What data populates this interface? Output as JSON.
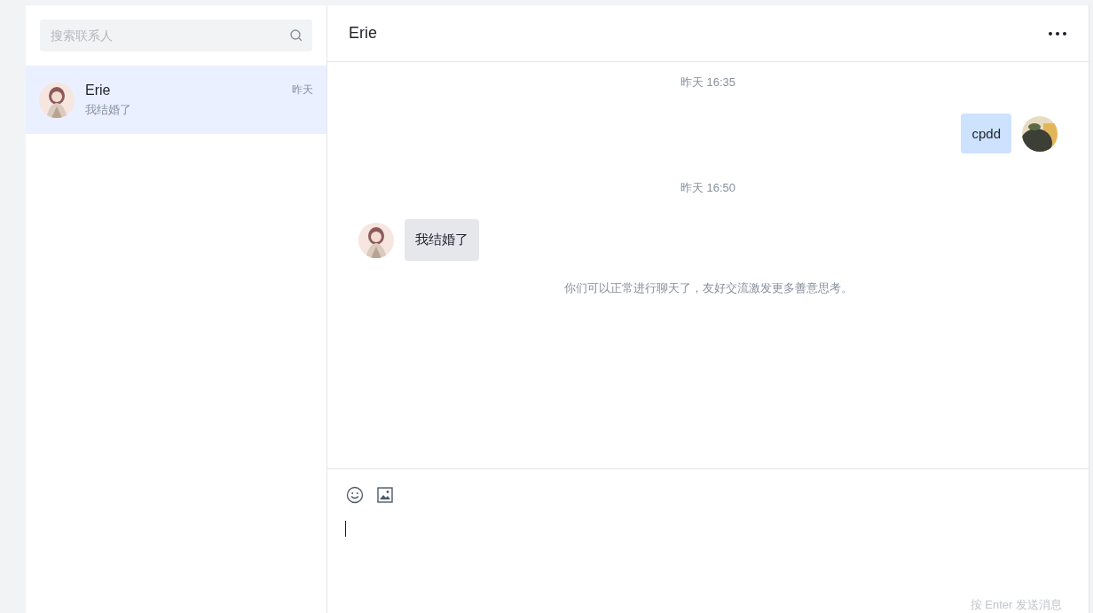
{
  "search": {
    "placeholder": "搜索联系人"
  },
  "contacts": [
    {
      "name": "Erie",
      "preview": "我结婚了",
      "time": "昨天",
      "selected": true
    }
  ],
  "chat": {
    "title": "Erie",
    "messages": [
      {
        "kind": "time",
        "text": "昨天 16:35"
      },
      {
        "kind": "out",
        "text": "cpdd"
      },
      {
        "kind": "time",
        "text": "昨天 16:50"
      },
      {
        "kind": "in",
        "text": "我结婚了"
      },
      {
        "kind": "notice",
        "text": "你们可以正常进行聊天了，友好交流激发更多善意思考。"
      }
    ],
    "hint": "按 Enter 发送消息"
  }
}
